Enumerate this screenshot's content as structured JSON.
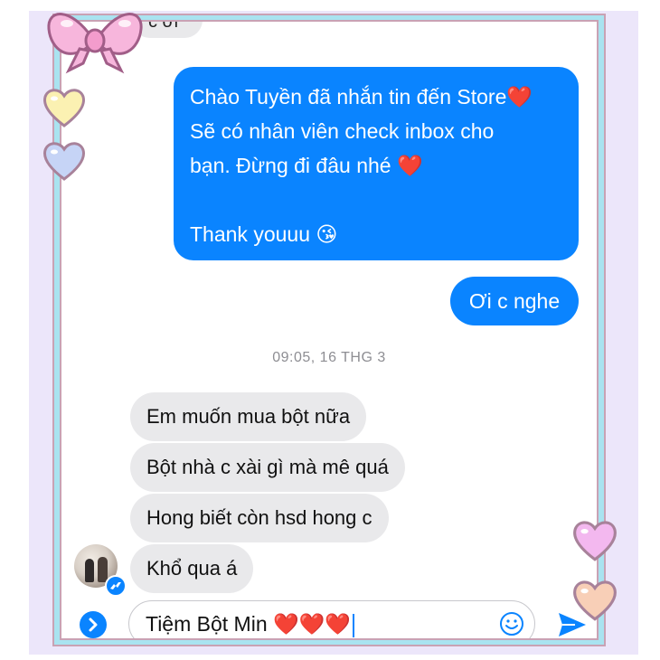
{
  "chat": {
    "partial_incoming": "c ơi",
    "outgoing_main": "Chào Tuyền đã nhắn tin đến Store❤️\nSẽ có nhân viên check inbox cho\nbạn. Đừng đi đâu nhé ❤️\n\nThank youuu 😘",
    "outgoing_short": "Ơi c nghe",
    "timestamp": "09:05, 16 THG 3",
    "incoming": [
      "Em muốn mua bột nữa",
      "Bột nhà c xài gì mà mê quá",
      "Hong biết còn hsd hong c",
      "Khổ qua á"
    ]
  },
  "composer": {
    "value": "Tiệm Bột Min ❤️❤️❤️"
  },
  "icons": {
    "expand": "chevron-right-icon",
    "emoji": "smiley-icon",
    "send": "send-icon",
    "badge": "messenger-icon"
  },
  "colors": {
    "outgoing_bubble": "#0a84ff",
    "incoming_bubble": "#e9e9eb",
    "frame_border": "#a9e3f0",
    "frame_background": "#ece6fa"
  }
}
